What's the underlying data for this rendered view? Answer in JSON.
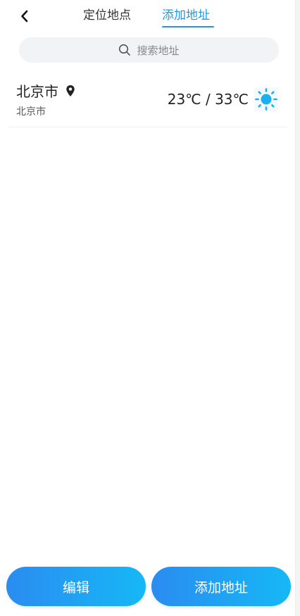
{
  "header": {
    "tabs": [
      {
        "label": "定位地点",
        "active": false
      },
      {
        "label": "添加地址",
        "active": true
      }
    ]
  },
  "search": {
    "placeholder": "搜索地址"
  },
  "locations": [
    {
      "name": "北京市",
      "subtitle": "北京市",
      "temperature": "23℃ / 33℃",
      "weather_icon": "sun-icon",
      "is_current": true
    }
  ],
  "footer": {
    "edit_label": "编辑",
    "add_label": "添加地址"
  },
  "colors": {
    "accent": "#1a9be8",
    "button_gradient_start": "#2a8cf0",
    "button_gradient_end": "#16b8f6",
    "sun": "#1bb0f2"
  }
}
